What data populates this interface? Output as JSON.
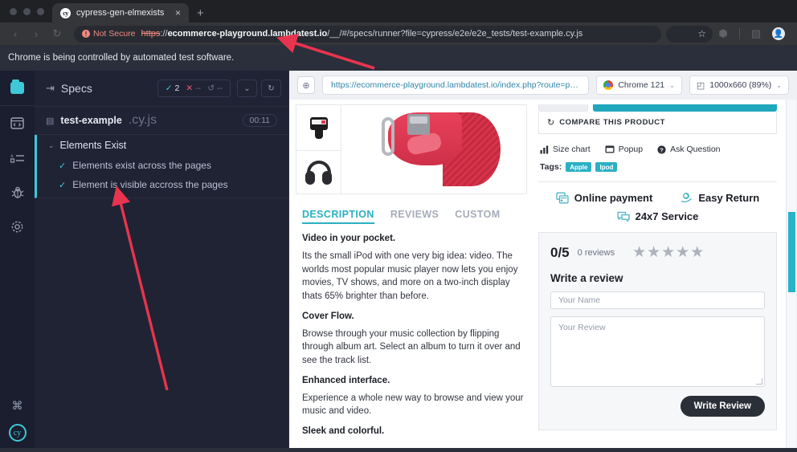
{
  "browser": {
    "tab": {
      "title": "cypress-gen-elmexists",
      "favicon": "cypress-icon",
      "close": "×",
      "new_tab": "+"
    },
    "nav": {
      "back": "‹",
      "forward": "›",
      "reload": "↻"
    },
    "omnibox": {
      "security_label": "Not Secure",
      "security_icon": "ⓧ",
      "url_scheme": "https",
      "url_sep": "://",
      "url_host": "ecommerce-playground.lambdatest.io",
      "url_path": "/__/#/specs/runner?file=cypress/e2e/e2e_tests/test-example.cy.js"
    },
    "toolbar": {
      "bookmark_icon": "☆",
      "extensions_icon": "⬢",
      "split_icon": "▧",
      "profile_icon": "●"
    },
    "automation_notice": "Chrome is being controlled by automated test software."
  },
  "cypress": {
    "iconbar": {
      "project_logo": "project-logo",
      "items": [
        {
          "name": "specs-icon",
          "glyph": "⬚"
        },
        {
          "name": "runs-icon",
          "glyph": "≡"
        },
        {
          "name": "debug-icon",
          "glyph": "☸"
        },
        {
          "name": "settings-icon",
          "glyph": "⚙"
        }
      ],
      "keyboard_icon": "⌘",
      "cypress_logo": "cy"
    },
    "header": {
      "menu_icon": "⇥",
      "title": "Specs",
      "stats": [
        {
          "name": "passed",
          "icon": "✓",
          "value": "2"
        },
        {
          "name": "failed",
          "icon": "✕",
          "value": "--"
        },
        {
          "name": "pending",
          "icon": "↺",
          "value": "--"
        }
      ],
      "collapse_icon": "⌄",
      "rerun_icon": "↻"
    },
    "spec": {
      "file_icon": "▤",
      "name": "test-example",
      "extension": ".cy.js",
      "duration": "00:11"
    },
    "suite": {
      "chevron": "⌄",
      "name": "Elements Exist",
      "tests": [
        {
          "status_icon": "✓",
          "name": "Elements exist across the pages"
        },
        {
          "status_icon": "✓",
          "name": "Element is visible accross the pages"
        }
      ]
    }
  },
  "aut": {
    "toolbar": {
      "selector_playground_icon": "⊕",
      "url": "https://ecommerce-playground.lambdatest.io/index.php?route=product/...",
      "browser_label": "Chrome 121",
      "browser_caret": "⌄",
      "viewport_label": "1000x660 (89%)",
      "viewport_icon": "◰",
      "viewport_caret": "⌄"
    }
  },
  "store": {
    "gallery": {
      "thumbnails": [
        "apple-watch-thumbnail",
        "headphones-thumbnail"
      ],
      "main_image": "red-watch-band"
    },
    "tabs": [
      {
        "label": "DESCRIPTION",
        "active": true
      },
      {
        "label": "REVIEWS",
        "active": false
      },
      {
        "label": "CUSTOM",
        "active": false
      }
    ],
    "description": [
      {
        "type": "heading",
        "text": "Video in your pocket."
      },
      {
        "type": "paragraph",
        "text": "Its the small iPod with one very big idea: video. The worlds most popular music player now lets you enjoy movies, TV shows, and more on a two-inch display thats 65% brighter than before."
      },
      {
        "type": "heading",
        "text": "Cover Flow."
      },
      {
        "type": "paragraph",
        "text": "Browse through your music collection by flipping through album art. Select an album to turn it over and see the track list."
      },
      {
        "type": "heading",
        "text": "Enhanced interface."
      },
      {
        "type": "paragraph",
        "text": "Experience a whole new way to browse and view your music and video."
      },
      {
        "type": "heading",
        "text": "Sleek and colorful."
      }
    ],
    "compare": {
      "icon": "↻",
      "label": "COMPARE THIS PRODUCT"
    },
    "links": [
      {
        "icon": "Ὄa",
        "glyph": "▐",
        "label": "Size chart",
        "name": "size-chart-link"
      },
      {
        "icon": "popup",
        "glyph": "▤",
        "label": "Popup",
        "name": "popup-link"
      },
      {
        "icon": "question",
        "glyph": "?",
        "label": "Ask Question",
        "name": "ask-question-link"
      }
    ],
    "tags": {
      "label": "Tags:",
      "values": [
        "Apple",
        "Ipod"
      ]
    },
    "services": [
      {
        "icon": "Ὃ3",
        "glyph": "⧉",
        "label": "Online payment"
      },
      {
        "icon": "return",
        "glyph": "⟲",
        "label": "Easy Return"
      },
      {
        "icon": "chat",
        "glyph": "⚉",
        "label": "24x7 Service"
      }
    ],
    "reviews": {
      "score": "0/5",
      "count": "0 reviews",
      "stars": "★★★★★",
      "write_title": "Write a review",
      "name_placeholder": "Your Name",
      "review_placeholder": "Your Review",
      "submit_label": "Write Review"
    }
  },
  "colors": {
    "cypress_teal": "#3fc8d8",
    "store_teal": "#2bb0c4",
    "arrow_red": "#e8344e",
    "fail_red": "#e45b78",
    "dark_bg": "#1f2334"
  }
}
